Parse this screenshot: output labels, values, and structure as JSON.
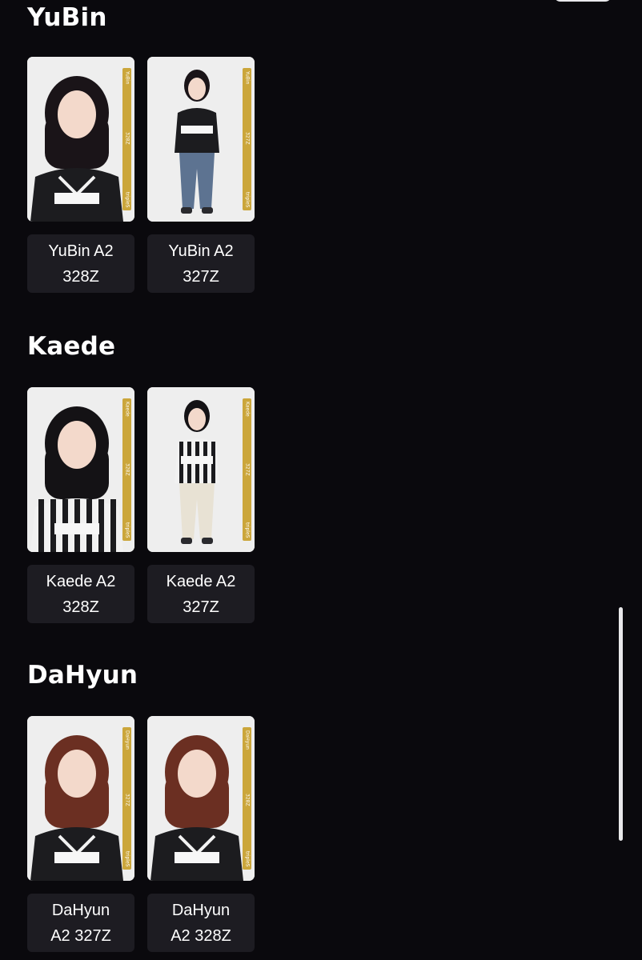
{
  "sections": [
    {
      "title": "YuBin",
      "cards": [
        {
          "line1": "YuBin A2",
          "line2": "328Z",
          "band_name": "YuBin",
          "band_code": "328Z",
          "band_brand": "tripleS",
          "hair": "#1a1418",
          "shirt": "#1c1c1f",
          "pose": "close"
        },
        {
          "line1": "YuBin A2",
          "line2": "327Z",
          "band_name": "YuBin",
          "band_code": "327Z",
          "band_brand": "tripleS",
          "hair": "#1a1418",
          "shirt": "#1c1c1f",
          "pose": "full"
        }
      ]
    },
    {
      "title": "Kaede",
      "cards": [
        {
          "line1": "Kaede A2",
          "line2": "328Z",
          "band_name": "Kaede",
          "band_code": "328Z",
          "band_brand": "tripleS",
          "hair": "#141215",
          "shirt": "#f1f1f1",
          "pose": "close"
        },
        {
          "line1": "Kaede A2",
          "line2": "327Z",
          "band_name": "Kaede",
          "band_code": "327Z",
          "band_brand": "tripleS",
          "hair": "#141215",
          "shirt": "#f1f1f1",
          "pose": "full"
        }
      ]
    },
    {
      "title": "DaHyun",
      "cards": [
        {
          "line1": "DaHyun",
          "line2": "A2 327Z",
          "band_name": "DaHyun",
          "band_code": "327Z",
          "band_brand": "tripleS",
          "hair": "#6b2f22",
          "shirt": "#1c1c1f",
          "pose": "close"
        },
        {
          "line1": "DaHyun",
          "line2": "A2 328Z",
          "band_name": "DaHyun",
          "band_code": "328Z",
          "band_brand": "tripleS",
          "hair": "#6b2f22",
          "shirt": "#1c1c1f",
          "pose": "close"
        }
      ]
    }
  ],
  "colors": {
    "background": "#0a090d",
    "card_label_bg": "#1d1c22",
    "band_gold": "#cba63b"
  }
}
